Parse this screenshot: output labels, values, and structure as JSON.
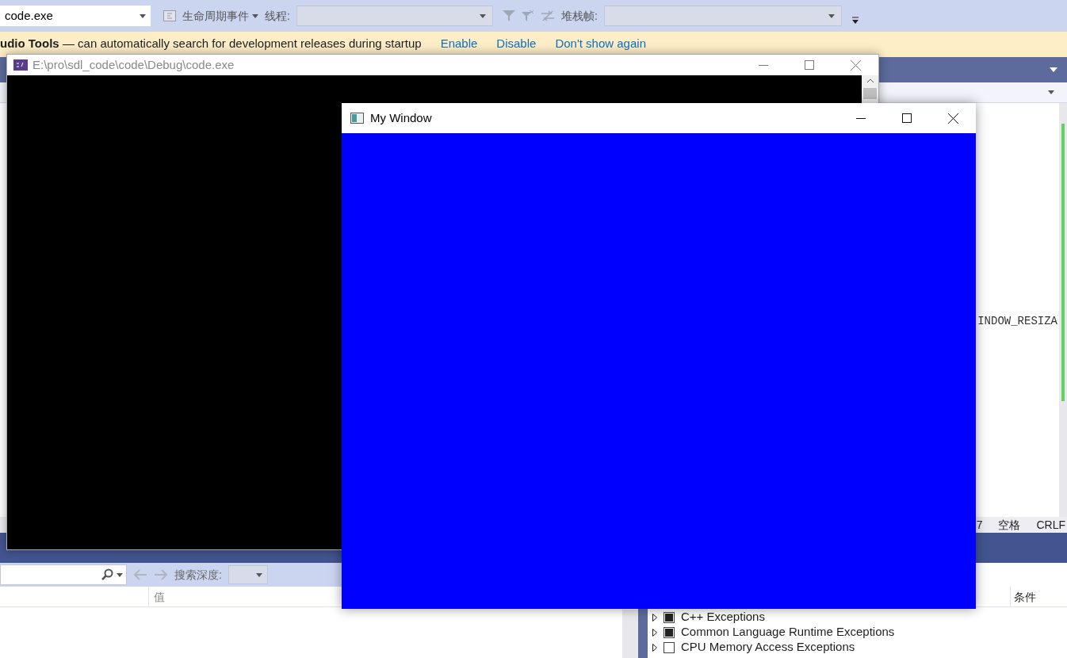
{
  "toolbar": {
    "process": "code.exe",
    "lifecycle_events": "生命周期事件",
    "thread_label": "线程:",
    "stack_frame_label": "堆栈帧:"
  },
  "info_bar": {
    "message": "**udio Tools** — can automatically search for development releases during startup",
    "links": [
      "Enable",
      "Disable",
      "Don't show again"
    ]
  },
  "editor": {
    "code_fragment": "INDOW_RESIZA",
    "status": [
      "7",
      "空格",
      "CRLF"
    ]
  },
  "locals_panel": {
    "search_depth_label": "搜索深度:",
    "columns": [
      "值"
    ]
  },
  "exceptions_panel": {
    "columns": [
      "条件"
    ],
    "items": [
      {
        "label": "C++ Exceptions",
        "checked": true
      },
      {
        "label": "Common Language Runtime Exceptions",
        "checked": true
      },
      {
        "label": "CPU Memory Access Exceptions",
        "checked": false
      }
    ]
  },
  "console_window": {
    "title": "E:\\pro\\sdl_code\\code\\Debug\\code.exe"
  },
  "sdl_window": {
    "title": "My Window"
  }
}
